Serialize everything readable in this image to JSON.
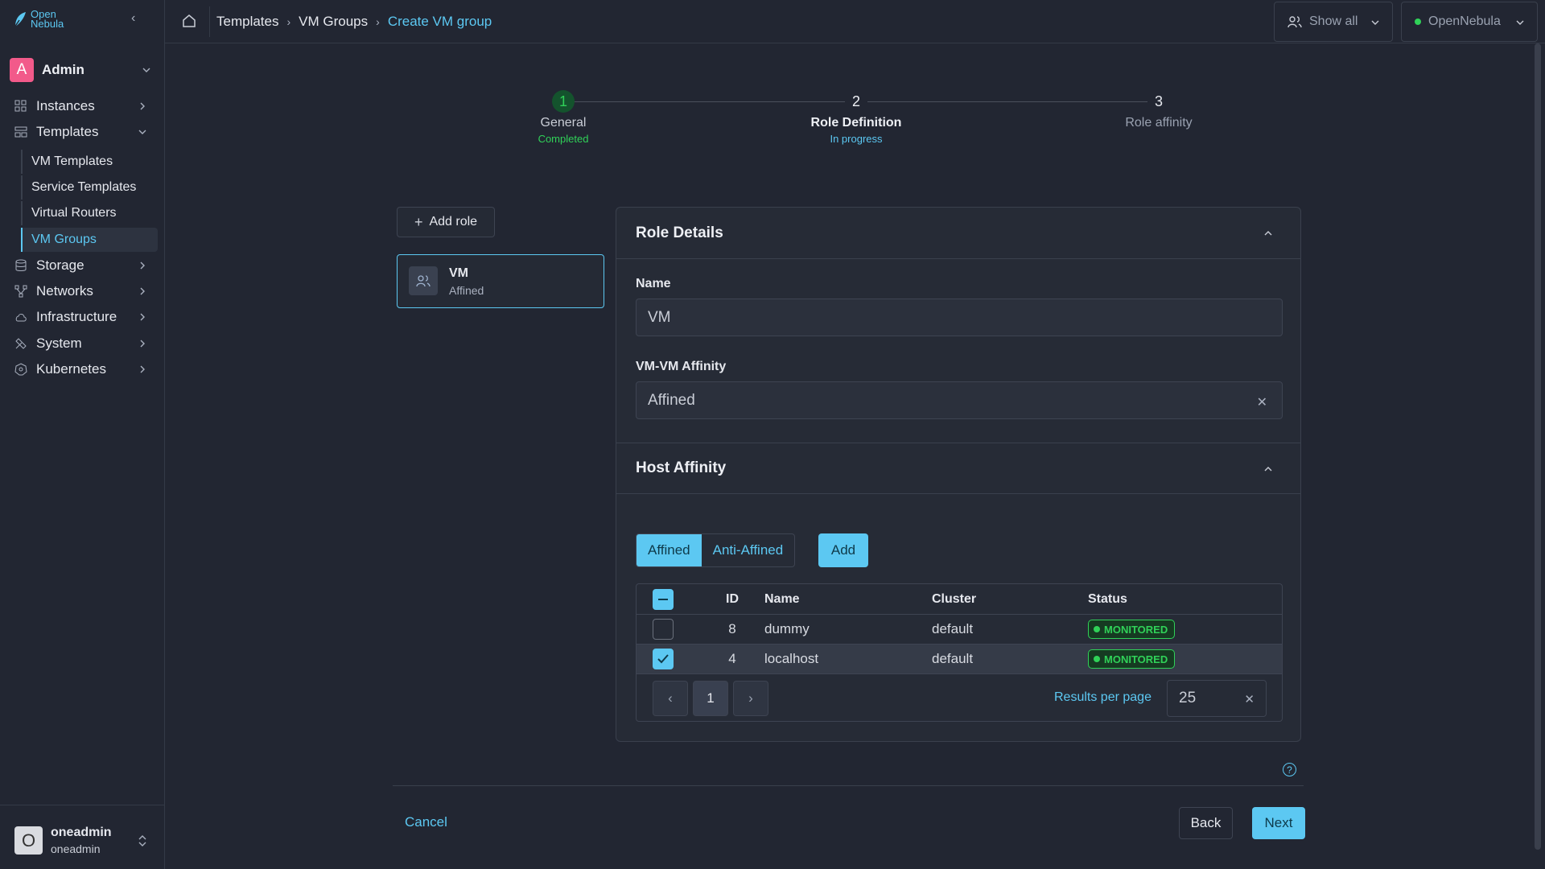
{
  "brand": {
    "line1": "Open",
    "line2": "Nebula",
    "accent": "#5cc8f2"
  },
  "user": {
    "initial": "A",
    "name": "Admin"
  },
  "sidebar": {
    "items": [
      {
        "label": "Instances",
        "icon": "instances-icon"
      },
      {
        "label": "Templates",
        "icon": "templates-icon"
      },
      {
        "label": "Storage",
        "icon": "storage-icon"
      },
      {
        "label": "Networks",
        "icon": "networks-icon"
      },
      {
        "label": "Infrastructure",
        "icon": "cloud-icon"
      },
      {
        "label": "System",
        "icon": "tools-icon"
      },
      {
        "label": "Kubernetes",
        "icon": "kubernetes-icon"
      }
    ],
    "templates_sub": [
      "VM Templates",
      "Service Templates",
      "Virtual Routers",
      "VM Groups"
    ]
  },
  "footer_user": {
    "initial": "O",
    "name": "oneadmin",
    "group": "oneadmin"
  },
  "breadcrumb": {
    "c1": "Templates",
    "c2": "VM Groups",
    "current": "Create VM group"
  },
  "topbar": {
    "show_all": "Show all",
    "zone": "OpenNebula"
  },
  "stepper": [
    {
      "num": "1",
      "title": "General",
      "status": "Completed"
    },
    {
      "num": "2",
      "title": "Role Definition",
      "status": "In progress"
    },
    {
      "num": "3",
      "title": "Role affinity",
      "status": ""
    }
  ],
  "roles": {
    "add_label": "Add role",
    "items": [
      {
        "name": "VM",
        "sub": "Affined"
      }
    ]
  },
  "role_details": {
    "title": "Role Details",
    "name_label": "Name",
    "name_value": "VM",
    "affinity_label": "VM-VM Affinity",
    "affinity_value": "Affined"
  },
  "host_affinity": {
    "title": "Host Affinity",
    "options": [
      "Affined",
      "Anti-Affined"
    ],
    "selected": "Affined",
    "add_label": "Add",
    "columns": [
      "ID",
      "Name",
      "Cluster",
      "Status"
    ],
    "rows": [
      {
        "id": "8",
        "name": "dummy",
        "cluster": "default",
        "status": "MONITORED",
        "checked": false
      },
      {
        "id": "4",
        "name": "localhost",
        "cluster": "default",
        "status": "MONITORED",
        "checked": true
      }
    ],
    "page": "1",
    "results_label": "Results per page",
    "results_value": "25"
  },
  "actions": {
    "cancel": "Cancel",
    "back": "Back",
    "next": "Next"
  }
}
